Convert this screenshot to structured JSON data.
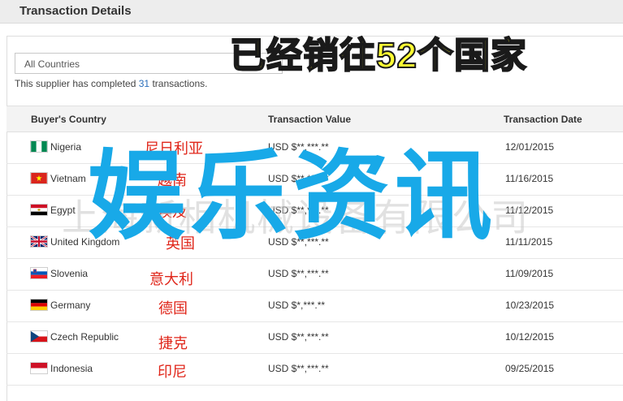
{
  "header": {
    "title": "Transaction Details"
  },
  "filter": {
    "selected": "All Countries"
  },
  "summary": {
    "prefix": "This supplier has completed ",
    "count": "31",
    "suffix": " transactions."
  },
  "table": {
    "columns": [
      "Buyer's Country",
      "Transaction Value",
      "Transaction Date"
    ],
    "rows": [
      {
        "country": "Nigeria",
        "flag": "nigeria-flag-icon",
        "value": "USD $**,***.**",
        "date": "12/01/2015",
        "cn": "尼日利亚"
      },
      {
        "country": "Vietnam",
        "flag": "vietnam-flag-icon",
        "value": "USD $**,***.**",
        "date": "11/16/2015",
        "cn": "越南"
      },
      {
        "country": "Egypt",
        "flag": "egypt-flag-icon",
        "value": "USD $**,***.**",
        "date": "11/12/2015",
        "cn": "埃及"
      },
      {
        "country": "United Kingdom",
        "flag": "uk-flag-icon",
        "value": "USD $**,***.**",
        "date": "11/11/2015",
        "cn": "英国"
      },
      {
        "country": "Slovenia",
        "flag": "slovenia-flag-icon",
        "value": "USD $**,***.**",
        "date": "11/09/2015",
        "cn": "意大利"
      },
      {
        "country": "Germany",
        "flag": "germany-flag-icon",
        "value": "USD $*,***.**",
        "date": "10/23/2015",
        "cn": "德国"
      },
      {
        "country": "Czech Republic",
        "flag": "czech-flag-icon",
        "value": "USD $**,***.**",
        "date": "10/12/2015",
        "cn": "捷克"
      },
      {
        "country": "Indonesia",
        "flag": "indonesia-flag-icon",
        "value": "USD $**,***.**",
        "date": "09/25/2015",
        "cn": "印尼"
      }
    ]
  },
  "overlays": {
    "banner": "已经销往52个国家",
    "watermark": "上海新相机械设备有限公司",
    "big_text": "娱乐资讯"
  },
  "colors": {
    "banner": "#ffff33",
    "big_text": "#18a9e8",
    "cn_label": "#e0261a",
    "count_link": "#2a6ebb"
  }
}
